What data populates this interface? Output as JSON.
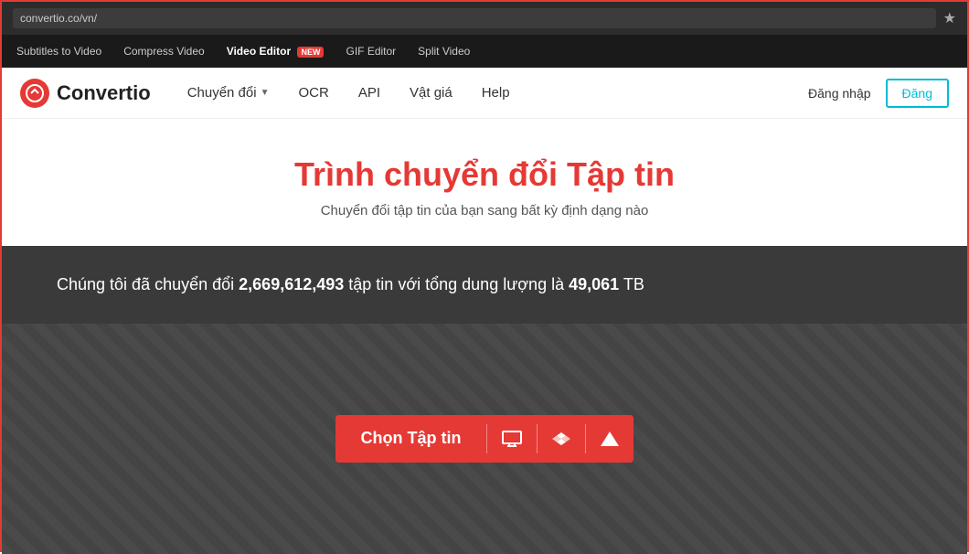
{
  "browser": {
    "url": "convertio.co/vn/",
    "star_icon": "★"
  },
  "top_menu": {
    "items": [
      {
        "label": "Subtitles to Video",
        "active": false
      },
      {
        "label": "Compress Video",
        "active": false
      },
      {
        "label": "Video Editor",
        "active": true,
        "badge": "NEW"
      },
      {
        "label": "GIF Editor",
        "active": false
      },
      {
        "label": "Split Video",
        "active": false
      }
    ]
  },
  "nav": {
    "logo_letter": "C",
    "logo_text": "Convertio",
    "links": [
      {
        "label": "Chuyển đổi",
        "has_chevron": true
      },
      {
        "label": "OCR",
        "has_chevron": false
      },
      {
        "label": "API",
        "has_chevron": false
      },
      {
        "label": "Vật giá",
        "has_chevron": false
      },
      {
        "label": "Help",
        "has_chevron": false
      }
    ],
    "login_label": "Đăng nhập",
    "register_label": "Đăng"
  },
  "hero": {
    "title": "Trình chuyển đổi Tập tin",
    "subtitle": "Chuyển đổi tập tin của bạn sang bất kỳ định dạng nào"
  },
  "stats": {
    "prefix": "Chúng tôi đã chuyển đổi ",
    "files_count": "2,669,612,493",
    "middle": " tập tin với tổng dung lượng là ",
    "tb_count": "49,061",
    "suffix": " TB"
  },
  "upload": {
    "button_label": "Chọn Tập tin",
    "icon_monitor": "🖥",
    "icon_dropbox": "✦",
    "icon_drive": "▲"
  }
}
